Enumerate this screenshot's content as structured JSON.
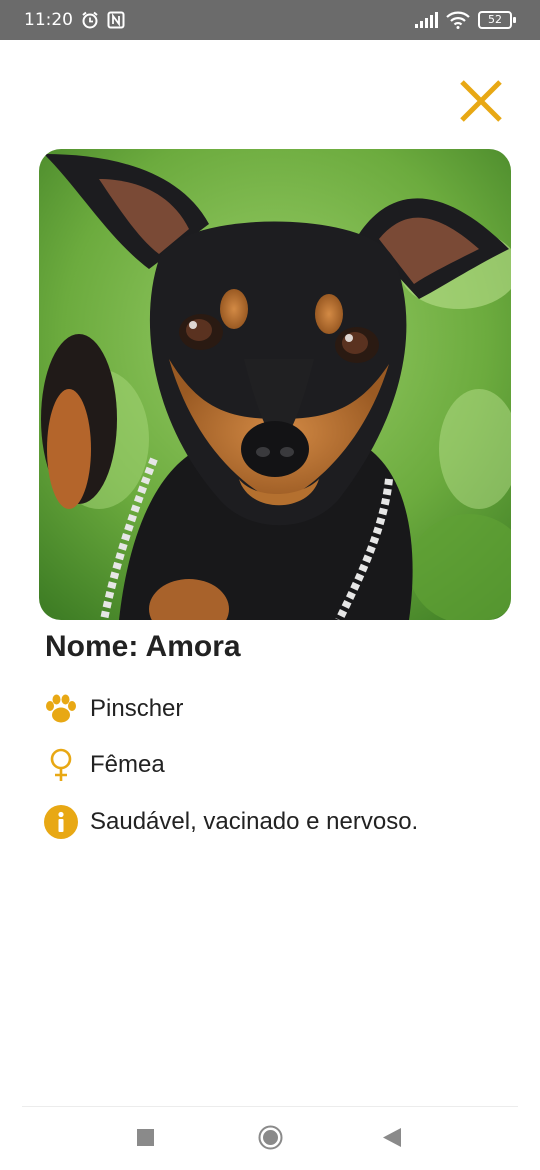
{
  "status_bar": {
    "time": "11:20",
    "battery": "52",
    "icons": [
      "alarm-icon",
      "nfc-icon",
      "signal-icon",
      "wifi-icon",
      "battery-icon"
    ]
  },
  "colors": {
    "accent": "#E8A814",
    "text": "#222222",
    "status_bar_bg": "#6b6b6b"
  },
  "pet": {
    "name_label": "Nome: Amora",
    "breed": "Pinscher",
    "gender": "Fêmea",
    "info": "Saudável, vacinado e nervoso.",
    "photo_subject": "black-and-tan miniature pinscher on grass"
  },
  "navigation": {
    "buttons": [
      "recents-button",
      "home-button",
      "back-button"
    ]
  }
}
